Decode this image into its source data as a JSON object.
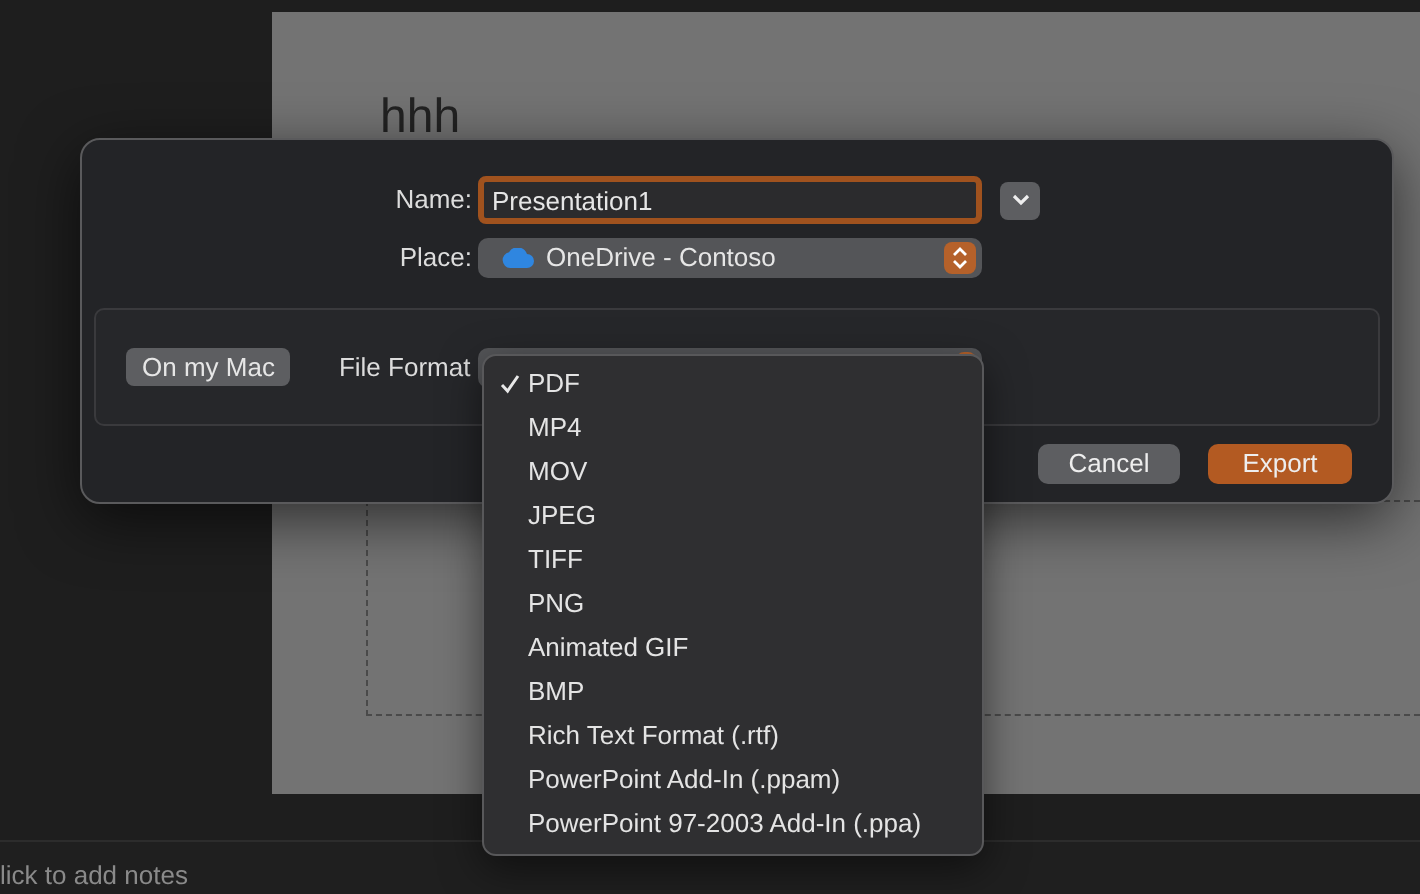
{
  "slide": {
    "title": "hhh"
  },
  "notes": {
    "placeholder": "lick to add notes"
  },
  "dialog": {
    "name_label": "Name:",
    "name_value": "Presentation1",
    "place_label": "Place:",
    "place_value": "OneDrive - Contoso",
    "location_button": "On my Mac",
    "format_label": "File Format",
    "buttons": [
      {
        "label": "Cancel",
        "kind": "secondary"
      },
      {
        "label": "Export",
        "kind": "primary"
      }
    ]
  },
  "format_menu": [
    {
      "label": "PDF",
      "checked": true
    },
    {
      "label": "MP4",
      "checked": false
    },
    {
      "label": "MOV",
      "checked": false
    },
    {
      "label": "JPEG",
      "checked": false
    },
    {
      "label": "TIFF",
      "checked": false
    },
    {
      "label": "PNG",
      "checked": false
    },
    {
      "label": "Animated GIF",
      "checked": false
    },
    {
      "label": "BMP",
      "checked": false
    },
    {
      "label": "Rich Text Format (.rtf)",
      "checked": false
    },
    {
      "label": "PowerPoint Add-In (.ppam)",
      "checked": false
    },
    {
      "label": "PowerPoint 97-2003 Add-In (.ppa)",
      "checked": false
    }
  ]
}
